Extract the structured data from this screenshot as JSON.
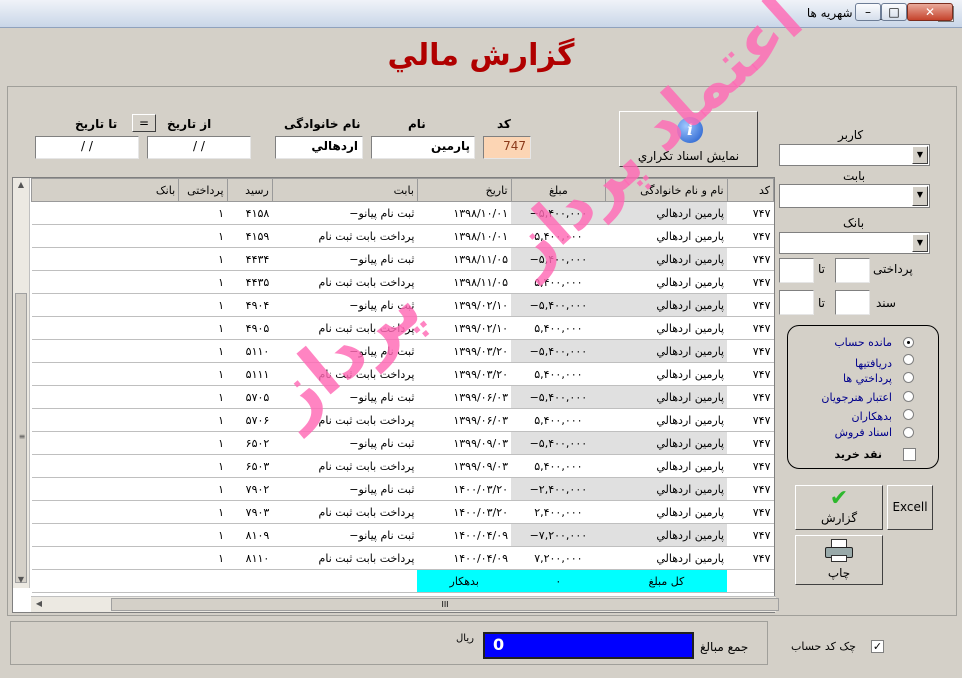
{
  "window": {
    "title": "گزارش دريافت شهريه ها",
    "minimize": "–",
    "maximize": "□",
    "close": "✕"
  },
  "heading": "گزارش مالي",
  "filters": {
    "code_label": "کد",
    "code_value": "747",
    "name_label": "نام",
    "name_value": "پارمين",
    "family_label": "نام خانوادگی",
    "family_value": "اردهالي",
    "from_date_label": "از تاريخ",
    "from_date_value": "/ /",
    "equals_button": "=",
    "to_date_label": "تا تاريخ",
    "to_date_value": "/ /"
  },
  "repeat_docs_button": "نمايش اسناد تکراري",
  "table": {
    "columns": [
      "کد",
      "نام و نام خانوادگی",
      "مبلغ",
      "تاريخ",
      "بابت",
      "رسيد",
      "پرداختی",
      "بانک"
    ],
    "rows": [
      [
        "۷۴۷",
        "پارمين اردهالي",
        "۵,۴۰۰,۰۰۰−",
        "۱۳۹۸/۱۰/۰۱",
        "ثبت نام پيانو−",
        "۴۱۵۸",
        "۱",
        ""
      ],
      [
        "۷۴۷",
        "پارمين اردهالي",
        "۵,۴۰۰,۰۰۰",
        "۱۳۹۸/۱۰/۰۱",
        "پرداخت بابت ثبت نام",
        "۴۱۵۹",
        "۱",
        ""
      ],
      [
        "۷۴۷",
        "پارمين اردهالي",
        "۵,۴۰۰,۰۰۰−",
        "۱۳۹۸/۱۱/۰۵",
        "ثبت نام پيانو−",
        "۴۴۳۴",
        "۱",
        ""
      ],
      [
        "۷۴۷",
        "پارمين اردهالي",
        "۵,۴۰۰,۰۰۰",
        "۱۳۹۸/۱۱/۰۵",
        "پرداخت بابت ثبت نام",
        "۴۴۳۵",
        "۱",
        ""
      ],
      [
        "۷۴۷",
        "پارمين اردهالي",
        "۵,۴۰۰,۰۰۰−",
        "۱۳۹۹/۰۲/۱۰",
        "ثبت نام پيانو−",
        "۴۹۰۴",
        "۱",
        ""
      ],
      [
        "۷۴۷",
        "پارمين اردهالي",
        "۵,۴۰۰,۰۰۰",
        "۱۳۹۹/۰۲/۱۰",
        "پرداخت بابت ثبت نام",
        "۴۹۰۵",
        "۱",
        ""
      ],
      [
        "۷۴۷",
        "پارمين اردهالي",
        "۵,۴۰۰,۰۰۰−",
        "۱۳۹۹/۰۳/۲۰",
        "ثبت نام پيانو−",
        "۵۱۱۰",
        "۱",
        ""
      ],
      [
        "۷۴۷",
        "پارمين اردهالي",
        "۵,۴۰۰,۰۰۰",
        "۱۳۹۹/۰۳/۲۰",
        "پرداخت بابت ثبت نام",
        "۵۱۱۱",
        "۱",
        ""
      ],
      [
        "۷۴۷",
        "پارمين اردهالي",
        "۵,۴۰۰,۰۰۰−",
        "۱۳۹۹/۰۶/۰۳",
        "ثبت نام پيانو−",
        "۵۷۰۵",
        "۱",
        ""
      ],
      [
        "۷۴۷",
        "پارمين اردهالي",
        "۵,۴۰۰,۰۰۰",
        "۱۳۹۹/۰۶/۰۳",
        "پرداخت بابت ثبت نام",
        "۵۷۰۶",
        "۱",
        ""
      ],
      [
        "۷۴۷",
        "پارمين اردهالي",
        "۵,۴۰۰,۰۰۰−",
        "۱۳۹۹/۰۹/۰۳",
        "ثبت نام پيانو−",
        "۶۵۰۲",
        "۱",
        ""
      ],
      [
        "۷۴۷",
        "پارمين اردهالي",
        "۵,۴۰۰,۰۰۰",
        "۱۳۹۹/۰۹/۰۳",
        "پرداخت بابت ثبت نام",
        "۶۵۰۳",
        "۱",
        ""
      ],
      [
        "۷۴۷",
        "پارمين اردهالي",
        "۲,۴۰۰,۰۰۰−",
        "۱۴۰۰/۰۳/۲۰",
        "ثبت نام پيانو−",
        "۷۹۰۲",
        "۱",
        ""
      ],
      [
        "۷۴۷",
        "پارمين اردهالي",
        "۲,۴۰۰,۰۰۰",
        "۱۴۰۰/۰۳/۲۰",
        "پرداخت بابت ثبت نام",
        "۷۹۰۳",
        "۱",
        ""
      ],
      [
        "۷۴۷",
        "پارمين اردهالي",
        "۷,۲۰۰,۰۰۰−",
        "۱۴۰۰/۰۴/۰۹",
        "ثبت نام پيانو−",
        "۸۱۰۹",
        "۱",
        ""
      ],
      [
        "۷۴۷",
        "پارمين اردهالي",
        "۷,۲۰۰,۰۰۰",
        "۱۴۰۰/۰۴/۰۹",
        "پرداخت بابت ثبت نام",
        "۸۱۱۰",
        "۱",
        ""
      ]
    ],
    "total_row": {
      "label": "کل مبلغ",
      "amount": "۰",
      "status": "بدهکار"
    },
    "scroll_grip": "III"
  },
  "right_panel": {
    "user_label": "کاربر",
    "user_value": "",
    "for_label": "بابت",
    "for_value": "",
    "bank_label": "بانک",
    "bank_value": "",
    "payment_label": "پرداختی",
    "doc_label": "سند",
    "to_label": "تا",
    "radio_options": [
      {
        "label": "مانده حساب",
        "selected": true
      },
      {
        "label": "دريافتيها",
        "selected": false
      },
      {
        "label": "پرداختي ها",
        "selected": false
      },
      {
        "label": "اعتبار هنرجويان",
        "selected": false
      },
      {
        "label": "بدهکاران",
        "selected": false
      },
      {
        "label": "اسناد فروش",
        "selected": false
      }
    ],
    "cash_only_label": "نقد خريد",
    "excel_button": "Excell",
    "report_button": "گزارش",
    "print_button": "چاپ"
  },
  "footer": {
    "sum_label": "جمع مبالغ",
    "sum_value": "0",
    "currency": "ريال",
    "check_code_label": "چک کد حساب",
    "check_code_checked": true
  },
  "watermark": "اعتماد پرداز",
  "colors": {
    "heading": "#b00000",
    "total_row": "#00ffff",
    "sum_box": "#0000ff",
    "watermark": "#ff69b4",
    "code_field": "#fcd5b4"
  }
}
